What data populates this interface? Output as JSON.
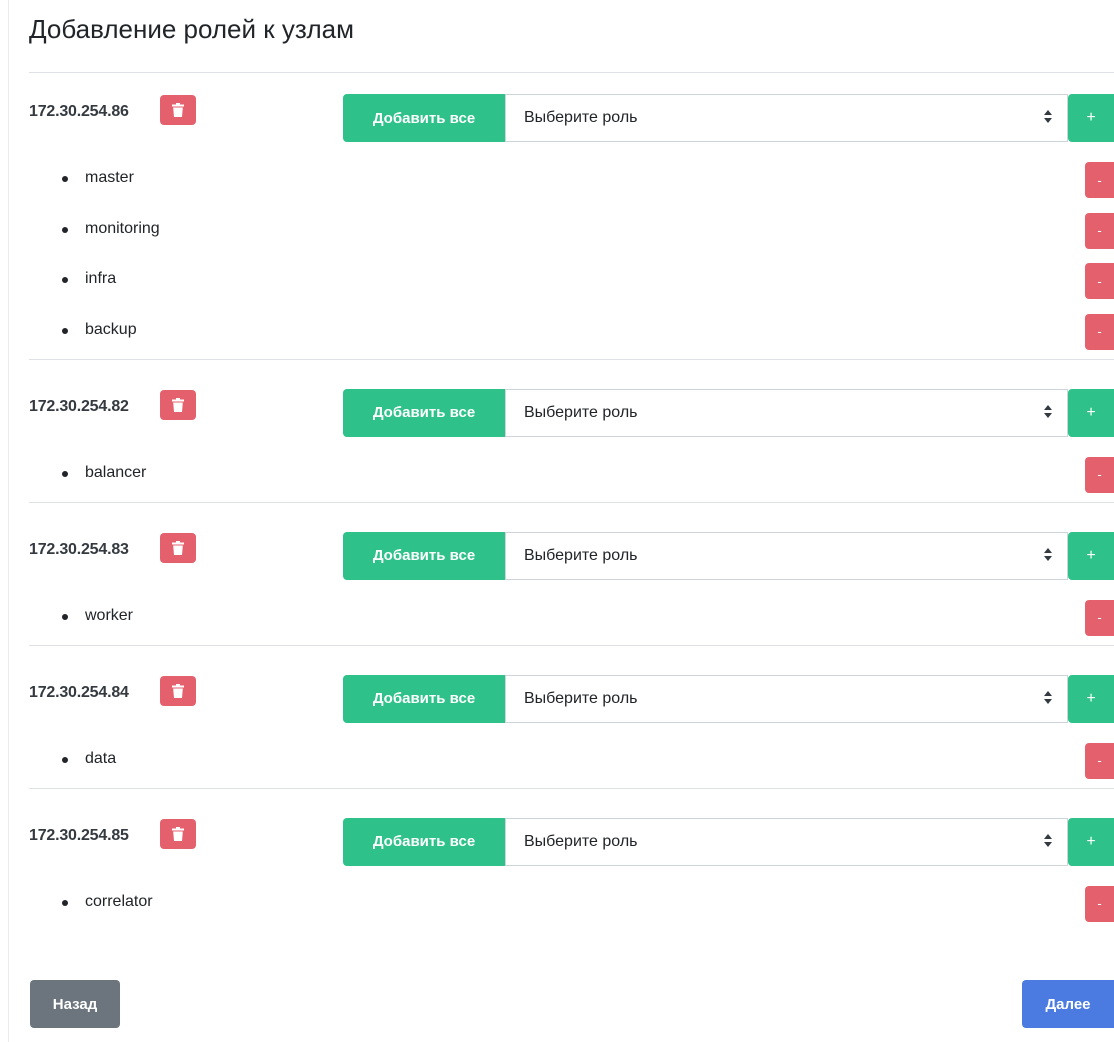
{
  "page": {
    "title": "Добавление ролей к узлам"
  },
  "labels": {
    "add_all": "Добавить все",
    "select_placeholder": "Выберите роль",
    "plus": "+",
    "minus": "-"
  },
  "nodes": [
    {
      "ip": "172.30.254.86",
      "roles": [
        "master",
        "monitoring",
        "infra",
        "backup"
      ]
    },
    {
      "ip": "172.30.254.82",
      "roles": [
        "balancer"
      ]
    },
    {
      "ip": "172.30.254.83",
      "roles": [
        "worker"
      ]
    },
    {
      "ip": "172.30.254.84",
      "roles": [
        "data"
      ]
    },
    {
      "ip": "172.30.254.85",
      "roles": [
        "correlator"
      ]
    }
  ],
  "footer": {
    "back_label": "Назад",
    "next_label": "Далее"
  },
  "icons": {
    "delete_node": "trash-icon",
    "select_arrows": "sort-arrows-icon"
  },
  "colors": {
    "success": "#2ec28a",
    "danger": "#e4606d",
    "secondary": "#6c757d",
    "primary": "#4b7be0"
  }
}
